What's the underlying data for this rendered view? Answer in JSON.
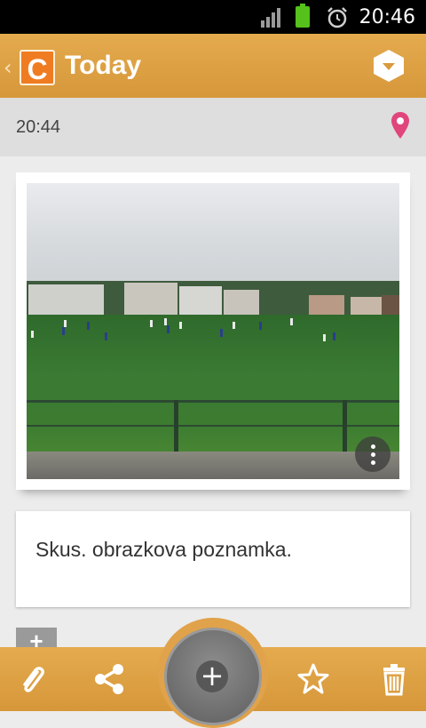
{
  "status_bar": {
    "time": "20:46"
  },
  "action_bar": {
    "title": "Today",
    "logo_letter": "C",
    "back_glyph": "‹"
  },
  "entry": {
    "time": "20:44"
  },
  "note": {
    "text": "Skus. obrazkova poznamka."
  },
  "add_small": {
    "label": "+"
  },
  "fab": {
    "label": "+"
  },
  "colors": {
    "accent": "#dea246",
    "logo": "#f07c22",
    "pin": "#e0457b"
  },
  "icons": [
    "signal-icon",
    "battery-icon",
    "alarm-icon",
    "back-icon",
    "app-logo",
    "hexagon-menu-icon",
    "location-pin-icon",
    "photo-menu-icon",
    "paperclip-icon",
    "share-icon",
    "add-icon",
    "star-icon",
    "trash-icon"
  ]
}
